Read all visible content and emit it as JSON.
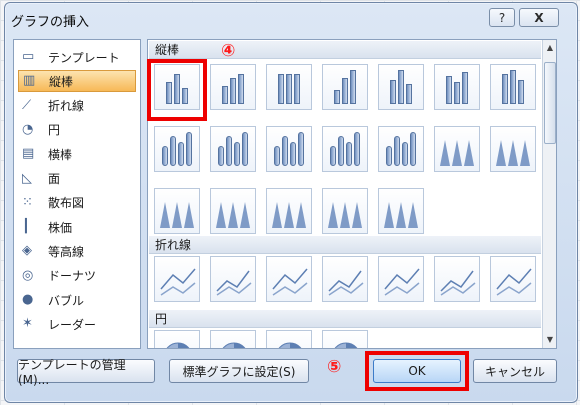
{
  "dialog": {
    "title": "グラフの挿入",
    "help_label": "?",
    "close_label": "X"
  },
  "sidebar": {
    "items": [
      {
        "label": "テンプレート",
        "icon": "folder-icon"
      },
      {
        "label": "縦棒",
        "icon": "column-chart-icon"
      },
      {
        "label": "折れ線",
        "icon": "line-chart-icon"
      },
      {
        "label": "円",
        "icon": "pie-chart-icon"
      },
      {
        "label": "横棒",
        "icon": "bar-chart-icon"
      },
      {
        "label": "面",
        "icon": "area-chart-icon"
      },
      {
        "label": "散布図",
        "icon": "scatter-chart-icon"
      },
      {
        "label": "株価",
        "icon": "stock-chart-icon"
      },
      {
        "label": "等高線",
        "icon": "surface-chart-icon"
      },
      {
        "label": "ドーナツ",
        "icon": "doughnut-chart-icon"
      },
      {
        "label": "バブル",
        "icon": "bubble-chart-icon"
      },
      {
        "label": "レーダー",
        "icon": "radar-chart-icon"
      }
    ],
    "selected_index": 1
  },
  "gallery": {
    "sections": [
      {
        "label": "縦棒"
      },
      {
        "label": "折れ線"
      },
      {
        "label": "円"
      }
    ]
  },
  "annotations": {
    "step4": "④",
    "step5": "⑤"
  },
  "buttons": {
    "manage": "テンプレートの管理(M)...",
    "set_default": "標準グラフに設定(S)",
    "ok": "OK",
    "cancel": "キャンセル"
  },
  "colors": {
    "highlight_red": "#ee0000",
    "selected_bg": "#f7b957",
    "accent_blue": "#3d7cc9"
  }
}
